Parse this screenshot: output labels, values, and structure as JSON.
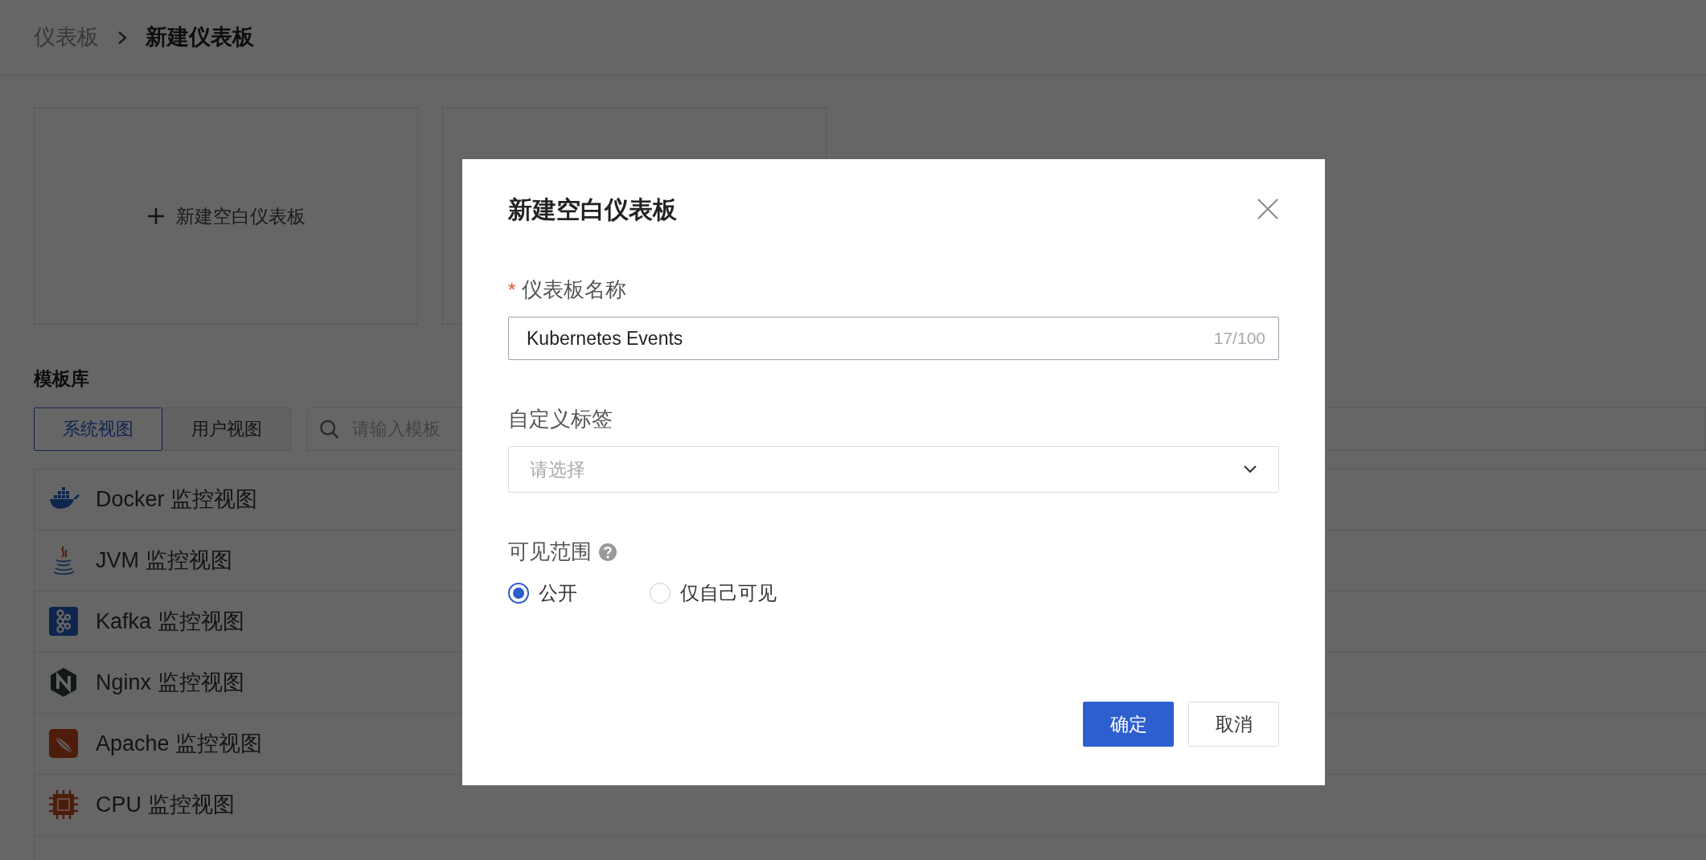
{
  "breadcrumb": [
    {
      "label": "仪表板",
      "current": false
    },
    {
      "label": "新建仪表板",
      "current": true
    }
  ],
  "create_cards": [
    {
      "kind": "create",
      "label": "新建空白仪表板"
    },
    {
      "kind": "covered"
    }
  ],
  "template_library": {
    "title": "模板库",
    "tabs": [
      {
        "label": "系统视图",
        "selected": true
      },
      {
        "label": "用户视图",
        "selected": false
      }
    ],
    "search": {
      "placeholder": "请输入模板"
    },
    "items": [
      {
        "kind": "docker",
        "label": "Docker 监控视图"
      },
      {
        "kind": "java",
        "label": "JVM 监控视图"
      },
      {
        "kind": "kafka",
        "label": "Kafka 监控视图"
      },
      {
        "kind": "nginx",
        "label": "Nginx 监控视图"
      },
      {
        "kind": "apache",
        "label": "Apache 监控视图"
      },
      {
        "kind": "cpu",
        "label": "CPU 监控视图"
      }
    ]
  },
  "dialog": {
    "title": "新建空白仪表板",
    "fields": [
      {
        "kind": "text",
        "label": "仪表板名称",
        "required_mark": "*",
        "value": "Kubernetes Events",
        "counter": "17/100"
      },
      {
        "kind": "select",
        "label": "自定义标签",
        "placeholder": "请选择"
      },
      {
        "kind": "radio",
        "label": "可见范围",
        "help": true,
        "options": [
          {
            "label": "公开",
            "selected": true
          },
          {
            "label": "仅自己可见",
            "selected": false
          }
        ]
      }
    ],
    "buttons": [
      {
        "kind": "primary",
        "label": "确定"
      },
      {
        "kind": "secondary",
        "label": "取消"
      }
    ]
  }
}
